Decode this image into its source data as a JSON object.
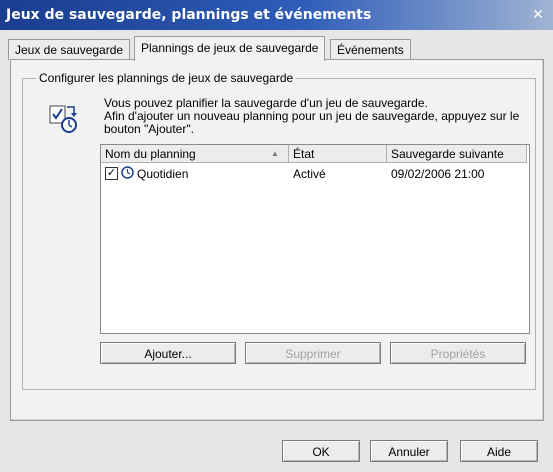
{
  "window": {
    "title": "Jeux de sauvegarde, plannings et événements",
    "close_glyph": "✕"
  },
  "tabs": [
    {
      "label": "Jeux de sauvegarde",
      "active": false
    },
    {
      "label": "Plannings de jeux de sauvegarde",
      "active": true
    },
    {
      "label": "Événements",
      "active": false
    }
  ],
  "group": {
    "legend": "Configurer les plannings de jeux de sauvegarde",
    "icon": "schedule-icon",
    "description_line1": "Vous pouvez planifier la sauvegarde d'un jeu de sauvegarde.",
    "description_line2": "Afin d'ajouter un nouveau planning pour un jeu de sauvegarde, appuyez sur le bouton \"Ajouter\"."
  },
  "list": {
    "columns": [
      "Nom du planning",
      "État",
      "Sauvegarde suivante"
    ],
    "sort_glyph": "▲",
    "rows": [
      {
        "name": "Quotidien",
        "state": "Activé",
        "next_backup": "09/02/2006 21:00",
        "checked": true,
        "check_glyph": "✓"
      }
    ]
  },
  "list_buttons": {
    "add": "Ajouter...",
    "delete": "Supprimer",
    "properties": "Propriétés"
  },
  "dialog_buttons": {
    "ok": "OK",
    "cancel": "Annuler",
    "help": "Aide"
  }
}
